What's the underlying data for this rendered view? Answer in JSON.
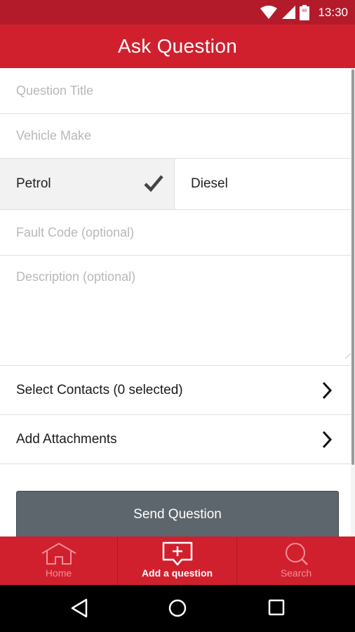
{
  "status_bar": {
    "time": "13:30",
    "battery_level": "69",
    "icons": [
      "wifi-icon",
      "cell-signal-icon",
      "battery-icon"
    ]
  },
  "header": {
    "title": "Ask Question"
  },
  "form": {
    "question_title_placeholder": "Question Title",
    "vehicle_make_placeholder": "Vehicle Make",
    "fuel_options": [
      {
        "label": "Petrol",
        "selected": true
      },
      {
        "label": "Diesel",
        "selected": false
      }
    ],
    "fault_code_placeholder": "Fault Code (optional)",
    "description_placeholder": "Description (optional)",
    "select_contacts_label": "Select Contacts (0 selected)",
    "add_attachments_label": "Add Attachments",
    "send_button_label": "Send Question"
  },
  "tab_bar": {
    "tabs": [
      {
        "label": "Home",
        "icon": "home-icon",
        "active": false
      },
      {
        "label": "Add a question",
        "icon": "add-question-icon",
        "active": true
      },
      {
        "label": "Search",
        "icon": "search-icon",
        "active": false
      }
    ]
  },
  "system_nav": {
    "icons": [
      "back-icon",
      "home-circle-icon",
      "recents-icon"
    ]
  },
  "colors": {
    "status_bar": "#b31b2a",
    "brand_red": "#d0202e",
    "send_button": "#5d666c",
    "placeholder_text": "#b8b8b8",
    "inactive_tab_text": "#f08f97"
  }
}
